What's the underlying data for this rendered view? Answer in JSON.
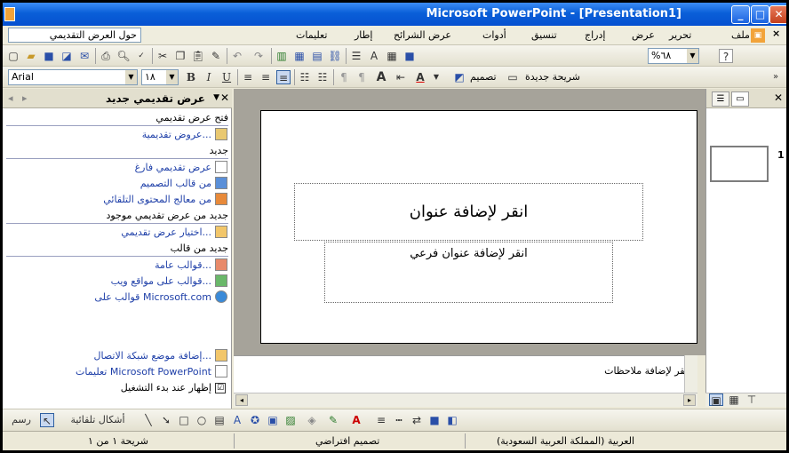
{
  "window": {
    "title": "Microsoft PowerPoint - [Presentation1]",
    "min": "_",
    "max": "□",
    "close": "✕"
  },
  "menubar": {
    "help_box": "حول العرض التقديمي",
    "items": [
      "ملف",
      "تحرير",
      "عرض",
      "إدراج",
      "تنسيق",
      "أدوات",
      "عرض الشرائح",
      "إطار",
      "تعليمات"
    ],
    "close_doc": "×"
  },
  "toolbar": {
    "zoom": "%٦٨",
    "help_icon": "?",
    "new_slide": "شريحة جديدة",
    "design": "تصميم",
    "font_name": "Arial",
    "font_size": "١٨",
    "bold": "B",
    "italic": "I",
    "underline": "U"
  },
  "taskpane": {
    "title": "عرض تقديمي جديد",
    "section_open": "فتح عرض تقديمي",
    "link_presentations": "عروض تقديمية...",
    "section_new": "جديد",
    "link_blank": "عرض تقديمي فارغ",
    "link_design_template": "من قالب التصميم",
    "link_autocontent": "من معالج المحتوى التلقائي",
    "section_existing": "جديد من عرض تقديمي موجود",
    "link_choose": "اختيار عرض تقديمي...",
    "section_template": "جديد من قالب",
    "link_general": "قوالب عامة...",
    "link_web": "قوالب على مواقع ويب...",
    "link_mscom": "قوالب على Microsoft.com",
    "link_network": "إضافة موضع شبكة الاتصال...",
    "link_help": "تعليمات Microsoft PowerPoint",
    "show_at_startup": "إظهار عند بدء التشغيل",
    "show_checked": "☑"
  },
  "slide": {
    "title_placeholder": "انقر لإضافة عنوان",
    "subtitle_placeholder": "انقر لإضافة عنوان فرعي"
  },
  "notes": {
    "placeholder": "انقر لإضافة ملاحظات"
  },
  "thumbs": {
    "slide_number": "1"
  },
  "drawing": {
    "draw_label": "رسم",
    "autoshapes": "أشكال تلقائية"
  },
  "status": {
    "slide_pos": "شريحة ١ من ١",
    "design": "تصميم افتراضي",
    "language": "العربية (المملكة العربية السعودية)"
  },
  "colors": {
    "titlebar": "#0A5FD8",
    "link": "#1E3FA8",
    "slide_bg": "#A6A39A"
  }
}
